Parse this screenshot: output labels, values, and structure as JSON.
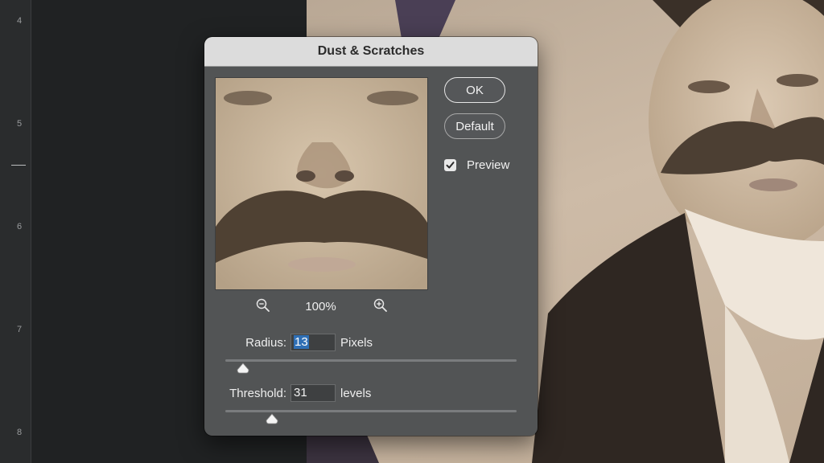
{
  "ruler": {
    "labels": [
      "4",
      "5",
      "6",
      "7",
      "8"
    ]
  },
  "dialog": {
    "title": "Dust & Scratches",
    "ok_label": "OK",
    "default_label": "Default",
    "preview_label": "Preview",
    "preview_checked": true,
    "zoom_level": "100%",
    "radius": {
      "label": "Radius:",
      "value": "13",
      "unit": "Pixels",
      "slider_fraction": 0.06
    },
    "threshold": {
      "label": "Threshold:",
      "value": "31",
      "unit": "levels",
      "slider_fraction": 0.16
    }
  },
  "icons": {
    "zoom_out": "zoom-out-icon",
    "zoom_in": "zoom-in-icon",
    "checkmark": "checkmark-icon"
  }
}
